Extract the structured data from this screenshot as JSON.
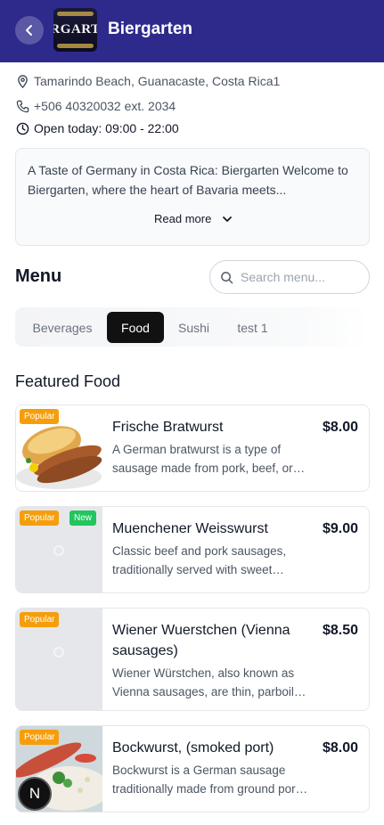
{
  "header": {
    "title": "Biergarten",
    "logo_text": "RGART"
  },
  "info": {
    "address": "Tamarindo Beach, Guanacaste, Costa Rica1",
    "phone": "+506 40320032 ext. 2034",
    "hours": "Open today: 09:00 - 22:00"
  },
  "about": {
    "text": "A Taste of Germany in Costa Rica: Biergarten Welcome to Biergarten, where the heart of Bavaria meets...",
    "read_more_label": "Read more"
  },
  "menu": {
    "title": "Menu",
    "search_placeholder": "Search menu...",
    "tabs": [
      {
        "label": "Beverages",
        "active": false
      },
      {
        "label": "Food",
        "active": true
      },
      {
        "label": "Sushi",
        "active": false
      },
      {
        "label": "test 1",
        "active": false
      }
    ],
    "section_title": "Featured Food",
    "items": [
      {
        "name": "Frische Bratwurst",
        "price": "$8.00",
        "description": "A German bratwurst is a type of sausage made from pork, beef, or…",
        "badges": [
          "Popular"
        ],
        "image": "bratwurst-photo"
      },
      {
        "name": "Muenchener Weisswurst",
        "price": "$9.00",
        "description": "Classic beef and pork sausages, traditionally served with sweet…",
        "badges": [
          "Popular",
          "New"
        ],
        "image": "placeholder"
      },
      {
        "name": "Wiener Wuerstchen (Vienna sausages)",
        "price": "$8.50",
        "description": "Wiener Würstchen, also known as Vienna sausages, are thin, parboil…",
        "badges": [
          "Popular"
        ],
        "image": "placeholder"
      },
      {
        "name": "Bockwurst, (smoked port)",
        "price": "$8.00",
        "description": "Bockwurst is a German sausage traditionally made from ground por…",
        "badges": [
          "Popular"
        ],
        "image": "bockwurst-photo"
      }
    ]
  },
  "fab": {
    "label": "N"
  },
  "colors": {
    "header_bg": "#2e2a8c",
    "popular_badge": "#f59e0b",
    "new_badge": "#22c55e",
    "active_tab": "#111111"
  }
}
